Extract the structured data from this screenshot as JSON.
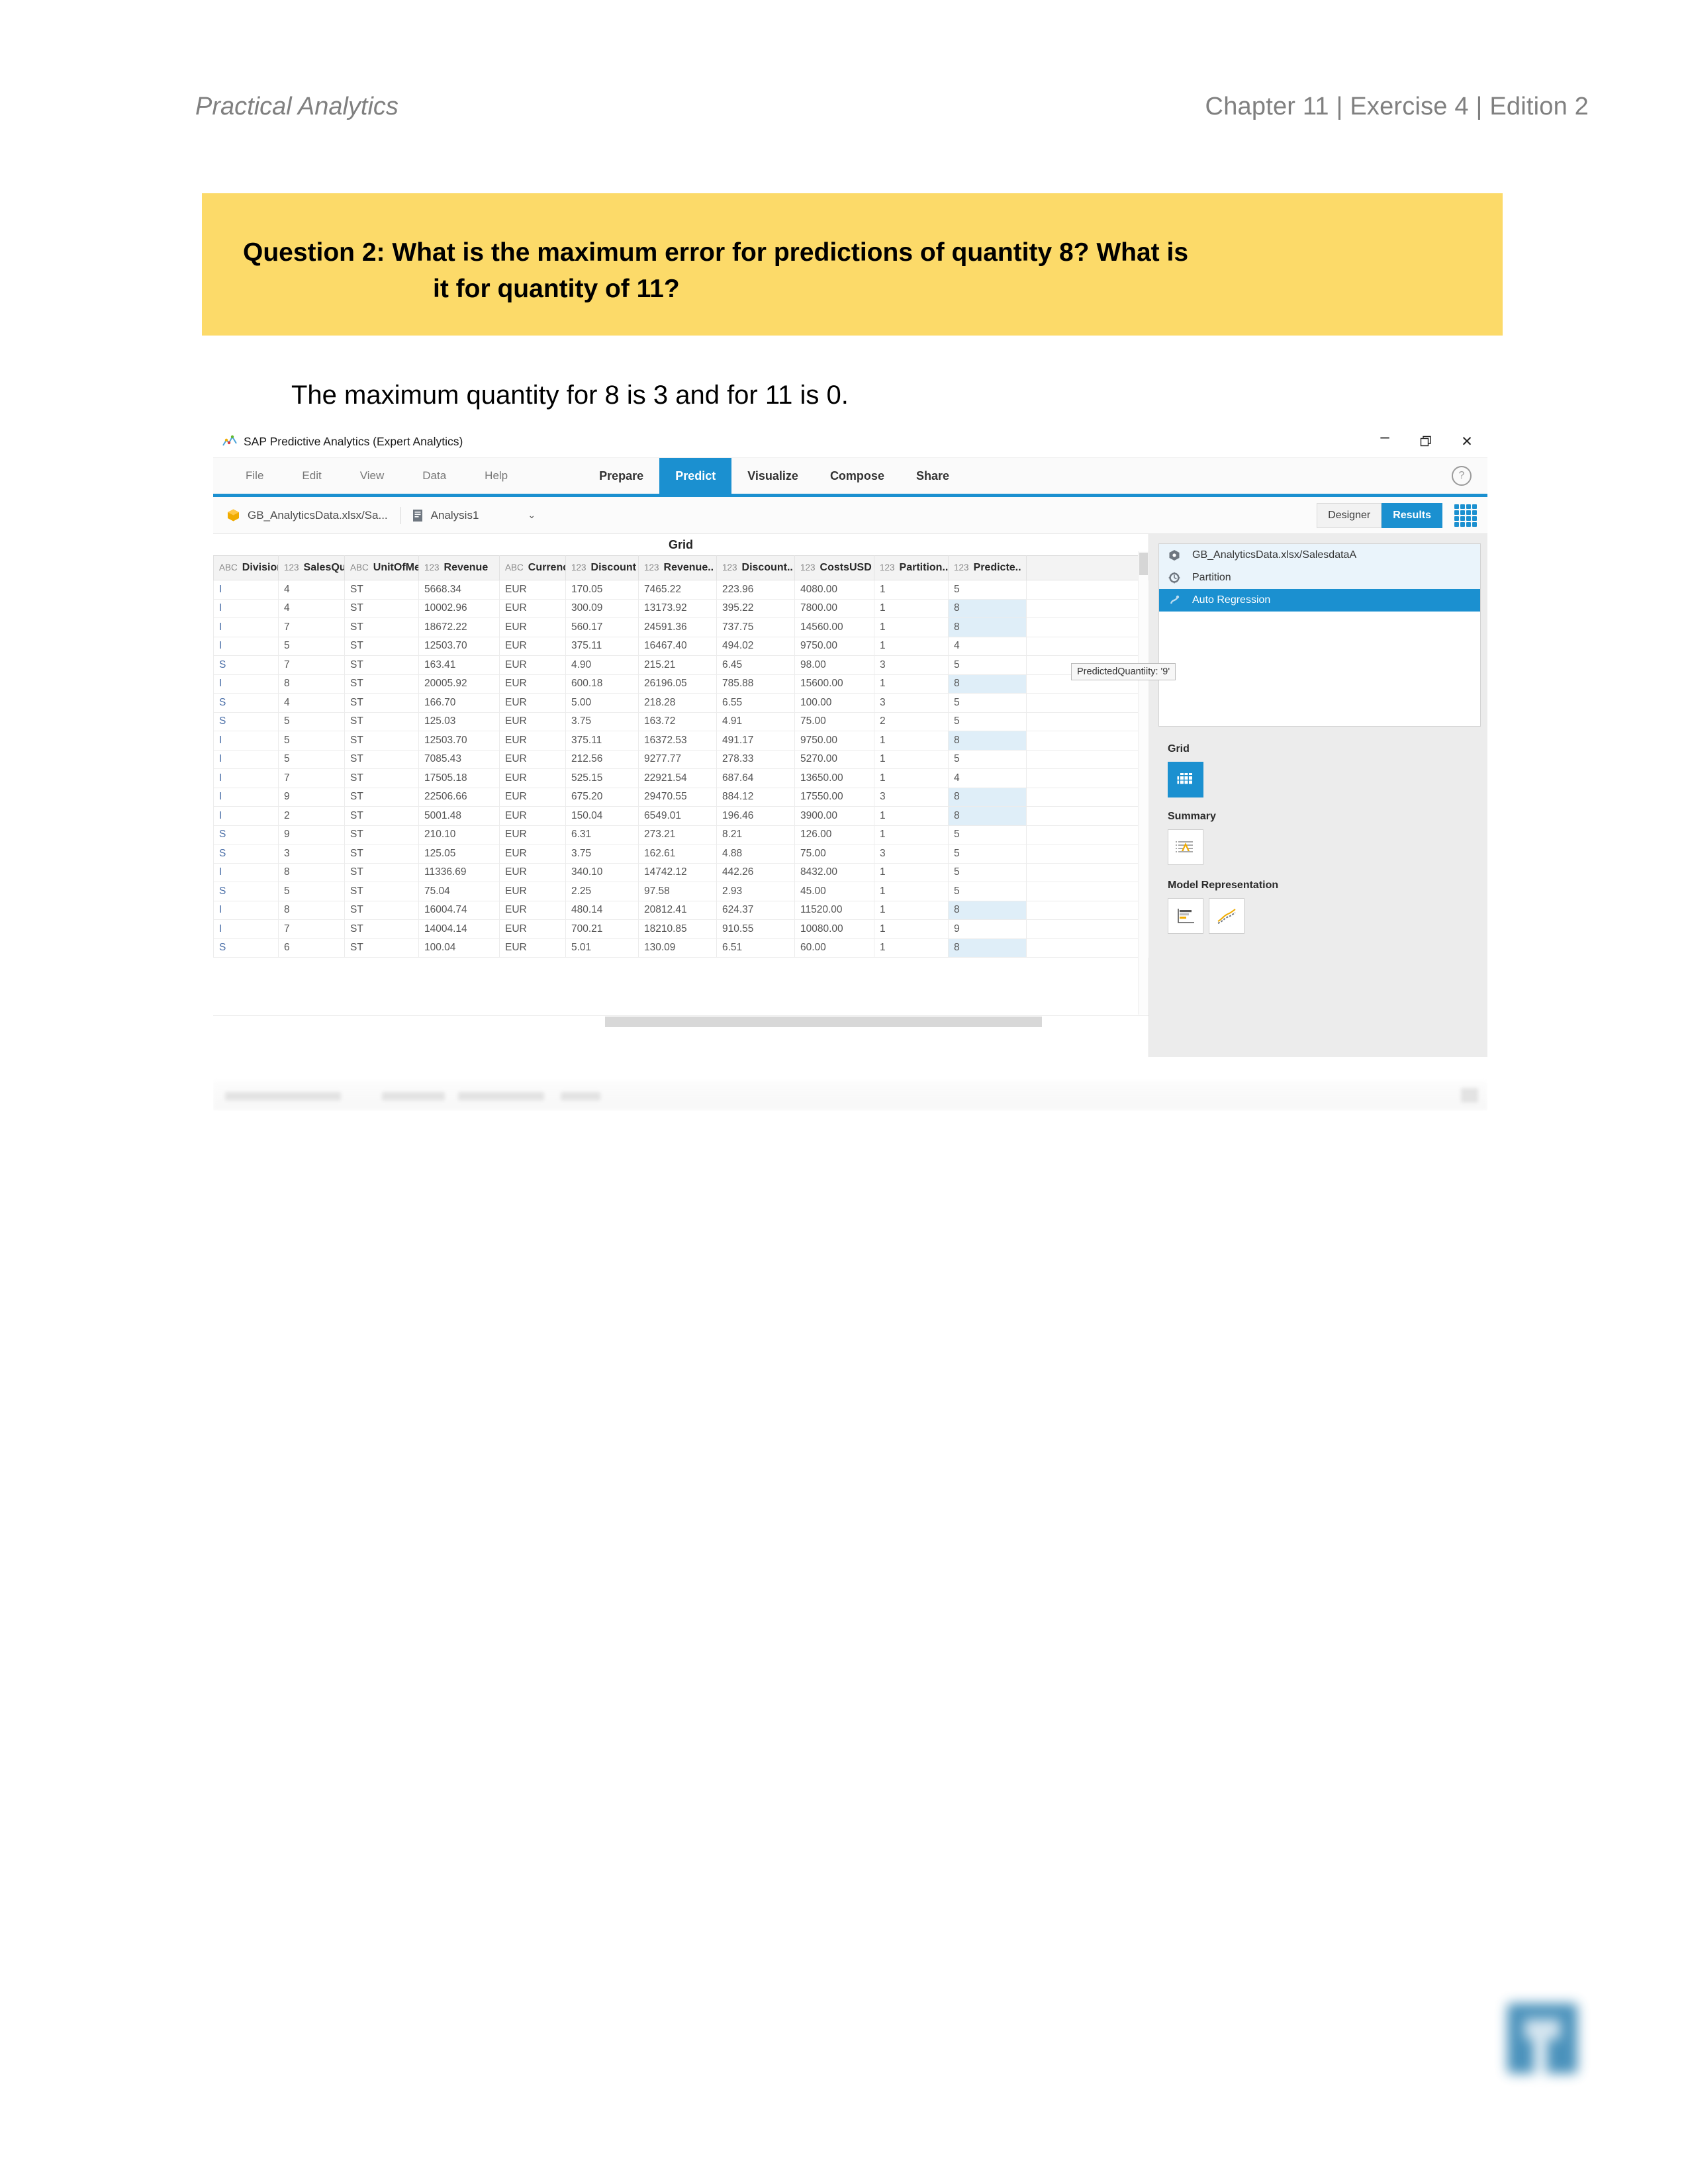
{
  "page_header": {
    "left": "Practical Analytics",
    "right": "Chapter 11 | Exercise 4 | Edition 2"
  },
  "question": {
    "label": "Question 2:",
    "line1": "What is the maximum error for predictions of quantity 8? What is",
    "line2": "it for quantity of 11?"
  },
  "answer": "The maximum quantity for 8 is 3 and for 11 is 0.",
  "app": {
    "title": "SAP Predictive Analytics (Expert Analytics)",
    "window_controls": {
      "minimize": "–",
      "restore": "❐",
      "close": "✕"
    },
    "menu": [
      "File",
      "Edit",
      "View",
      "Data",
      "Help"
    ],
    "tabs": [
      {
        "label": "Prepare",
        "active": false
      },
      {
        "label": "Predict",
        "active": true
      },
      {
        "label": "Visualize",
        "active": false
      },
      {
        "label": "Compose",
        "active": false
      },
      {
        "label": "Share",
        "active": false
      }
    ],
    "help_glyph": "?",
    "toolbar": {
      "dataset": "GB_AnalyticsData.xlsx/Sa...",
      "analysis": "Analysis1",
      "caret": "⌄",
      "designer": "Designer",
      "results": "Results"
    },
    "grid_caption": "Grid",
    "columns": [
      {
        "type": "ABC",
        "name": "Division"
      },
      {
        "type": "123",
        "name": "SalesQu.."
      },
      {
        "type": "ABC",
        "name": "UnitOfMe.."
      },
      {
        "type": "123",
        "name": "Revenue"
      },
      {
        "type": "ABC",
        "name": "Currency"
      },
      {
        "type": "123",
        "name": "Discount"
      },
      {
        "type": "123",
        "name": "Revenue.."
      },
      {
        "type": "123",
        "name": "Discount.."
      },
      {
        "type": "123",
        "name": "CostsUSD"
      },
      {
        "type": "123",
        "name": "Partition.."
      },
      {
        "type": "123",
        "name": "Predicte.."
      }
    ],
    "rows": [
      {
        "cells": [
          "I",
          "4",
          "ST",
          "5668.34",
          "EUR",
          "170.05",
          "7465.22",
          "223.96",
          "4080.00",
          "1",
          "5"
        ],
        "pred_hl": false
      },
      {
        "cells": [
          "I",
          "4",
          "ST",
          "10002.96",
          "EUR",
          "300.09",
          "13173.92",
          "395.22",
          "7800.00",
          "1",
          "8"
        ],
        "pred_hl": true
      },
      {
        "cells": [
          "I",
          "7",
          "ST",
          "18672.22",
          "EUR",
          "560.17",
          "24591.36",
          "737.75",
          "14560.00",
          "1",
          "8"
        ],
        "pred_hl": true
      },
      {
        "cells": [
          "I",
          "5",
          "ST",
          "12503.70",
          "EUR",
          "375.11",
          "16467.40",
          "494.02",
          "9750.00",
          "1",
          "4"
        ],
        "pred_hl": false
      },
      {
        "cells": [
          "S",
          "7",
          "ST",
          "163.41",
          "EUR",
          "4.90",
          "215.21",
          "6.45",
          "98.00",
          "3",
          "5"
        ],
        "pred_hl": false
      },
      {
        "cells": [
          "I",
          "8",
          "ST",
          "20005.92",
          "EUR",
          "600.18",
          "26196.05",
          "785.88",
          "15600.00",
          "1",
          "8"
        ],
        "pred_hl": true
      },
      {
        "cells": [
          "S",
          "4",
          "ST",
          "166.70",
          "EUR",
          "5.00",
          "218.28",
          "6.55",
          "100.00",
          "3",
          "5"
        ],
        "pred_hl": false
      },
      {
        "cells": [
          "S",
          "5",
          "ST",
          "125.03",
          "EUR",
          "3.75",
          "163.72",
          "4.91",
          "75.00",
          "2",
          "5"
        ],
        "pred_hl": false
      },
      {
        "cells": [
          "I",
          "5",
          "ST",
          "12503.70",
          "EUR",
          "375.11",
          "16372.53",
          "491.17",
          "9750.00",
          "1",
          "8"
        ],
        "pred_hl": true
      },
      {
        "cells": [
          "I",
          "5",
          "ST",
          "7085.43",
          "EUR",
          "212.56",
          "9277.77",
          "278.33",
          "5270.00",
          "1",
          "5"
        ],
        "pred_hl": false
      },
      {
        "cells": [
          "I",
          "7",
          "ST",
          "17505.18",
          "EUR",
          "525.15",
          "22921.54",
          "687.64",
          "13650.00",
          "1",
          "4"
        ],
        "pred_hl": false
      },
      {
        "cells": [
          "I",
          "9",
          "ST",
          "22506.66",
          "EUR",
          "675.20",
          "29470.55",
          "884.12",
          "17550.00",
          "3",
          "8"
        ],
        "pred_hl": true
      },
      {
        "cells": [
          "I",
          "2",
          "ST",
          "5001.48",
          "EUR",
          "150.04",
          "6549.01",
          "196.46",
          "3900.00",
          "1",
          "8"
        ],
        "pred_hl": true
      },
      {
        "cells": [
          "S",
          "9",
          "ST",
          "210.10",
          "EUR",
          "6.31",
          "273.21",
          "8.21",
          "126.00",
          "1",
          "5"
        ],
        "pred_hl": false
      },
      {
        "cells": [
          "S",
          "3",
          "ST",
          "125.05",
          "EUR",
          "3.75",
          "162.61",
          "4.88",
          "75.00",
          "3",
          "5"
        ],
        "pred_hl": false
      },
      {
        "cells": [
          "I",
          "8",
          "ST",
          "11336.69",
          "EUR",
          "340.10",
          "14742.12",
          "442.26",
          "8432.00",
          "1",
          "5"
        ],
        "pred_hl": false
      },
      {
        "cells": [
          "S",
          "5",
          "ST",
          "75.04",
          "EUR",
          "2.25",
          "97.58",
          "2.93",
          "45.00",
          "1",
          "5"
        ],
        "pred_hl": false
      },
      {
        "cells": [
          "I",
          "8",
          "ST",
          "16004.74",
          "EUR",
          "480.14",
          "20812.41",
          "624.37",
          "11520.00",
          "1",
          "8"
        ],
        "pred_hl": true
      },
      {
        "cells": [
          "I",
          "7",
          "ST",
          "14004.14",
          "EUR",
          "700.21",
          "18210.85",
          "910.55",
          "10080.00",
          "1",
          "9"
        ],
        "pred_hl": false
      },
      {
        "cells": [
          "S",
          "6",
          "ST",
          "100.04",
          "EUR",
          "5.01",
          "130.09",
          "6.51",
          "60.00",
          "1",
          "8"
        ],
        "pred_hl": true
      }
    ],
    "tooltip": "PredictedQuantiity: '9'",
    "pipeline": [
      {
        "label": "GB_AnalyticsData.xlsx/SalesdataA",
        "state": "light",
        "icon": "cube-icon"
      },
      {
        "label": "Partition",
        "state": "light",
        "icon": "chip-icon"
      },
      {
        "label": "Auto Regression",
        "state": "selected",
        "icon": "algorithm-icon"
      }
    ],
    "panels": [
      {
        "label": "Grid",
        "tiles": [
          "grid-tile-icon"
        ]
      },
      {
        "label": "Summary",
        "tiles": [
          "summary-tile-icon"
        ]
      },
      {
        "label": "Model Representation",
        "tiles": [
          "bars-tile-icon",
          "trend-tile-icon"
        ]
      }
    ]
  },
  "colors": {
    "accent_blue": "#1b90d0",
    "banner_yellow": "#FCDA69",
    "header_gray": "#808080",
    "highlight_row": "#dfeef8"
  }
}
